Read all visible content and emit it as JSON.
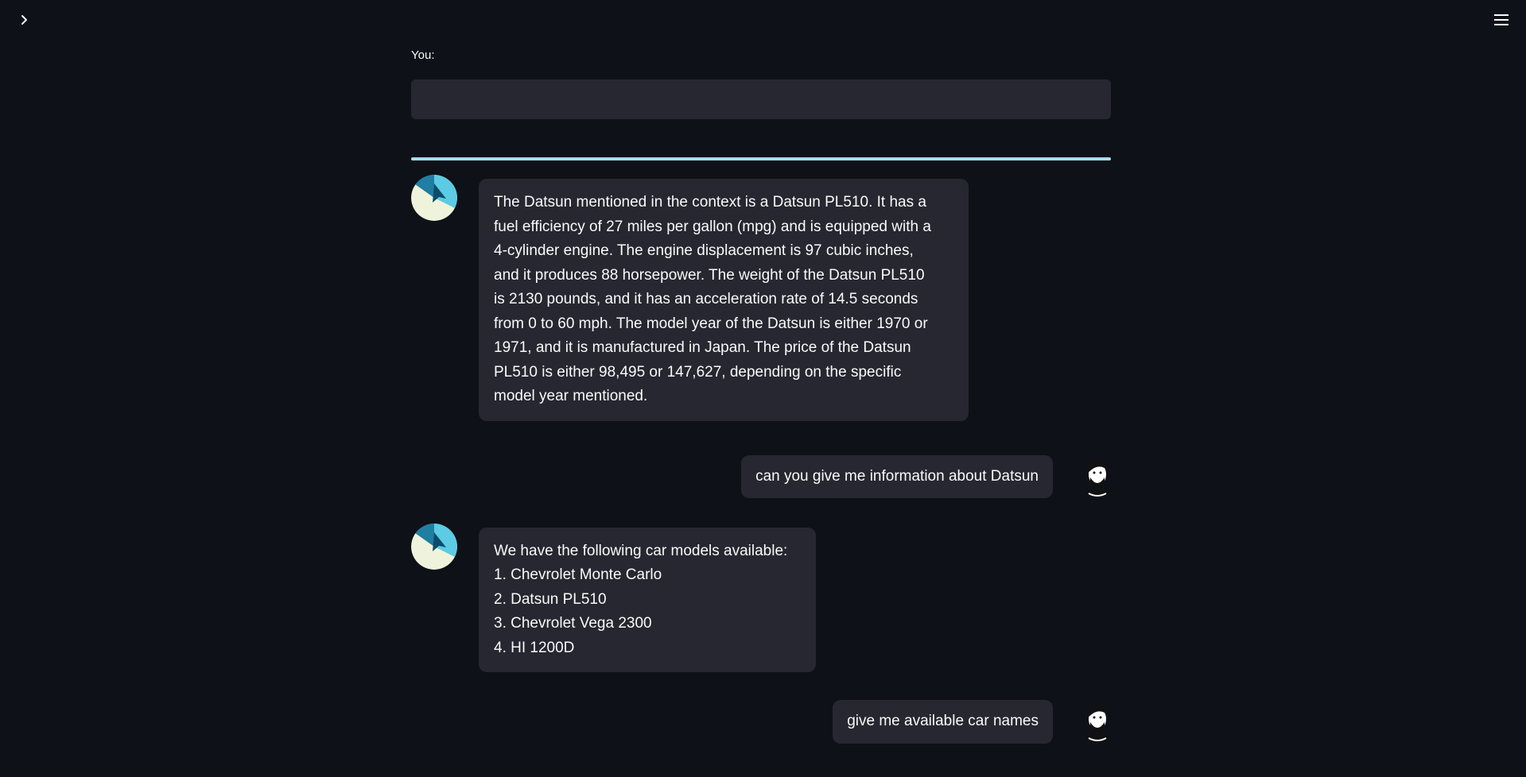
{
  "header": {
    "sidebar_toggle_icon": "chevron-right-icon",
    "menu_icon": "hamburger-menu-icon"
  },
  "input": {
    "label": "You:",
    "value": "",
    "placeholder": ""
  },
  "colors": {
    "background": "#0e1117",
    "bubble": "#262730",
    "divider": "#a8dcf0",
    "text": "#fafafa"
  },
  "messages": [
    {
      "role": "bot",
      "avatar": "bot-avatar-icon",
      "text": "The Datsun mentioned in the context is a Datsun PL510. It has a\nfuel efficiency of 27 miles per gallon (mpg) and is equipped with a\n4-cylinder engine. The engine displacement is 97 cubic inches,\nand it produces 88 horsepower. The weight of the Datsun PL510\nis 2130 pounds, and it has an acceleration rate of 14.5 seconds\nfrom 0 to 60 mph. The model year of the Datsun is either 1970 or\n1971, and it is manufactured in Japan. The price of the Datsun\nPL510 is either 98,495 or 147,627, depending on the specific\nmodel year mentioned."
    },
    {
      "role": "user",
      "avatar": "user-avatar-icon",
      "text": "can you give me information about Datsun"
    },
    {
      "role": "bot",
      "avatar": "bot-avatar-icon",
      "text": "We have the following car models available:\n1. Chevrolet Monte Carlo\n2. Datsun PL510\n3. Chevrolet Vega 2300\n4. HI 1200D"
    },
    {
      "role": "user",
      "avatar": "user-avatar-icon",
      "text": "give me available car names"
    }
  ]
}
